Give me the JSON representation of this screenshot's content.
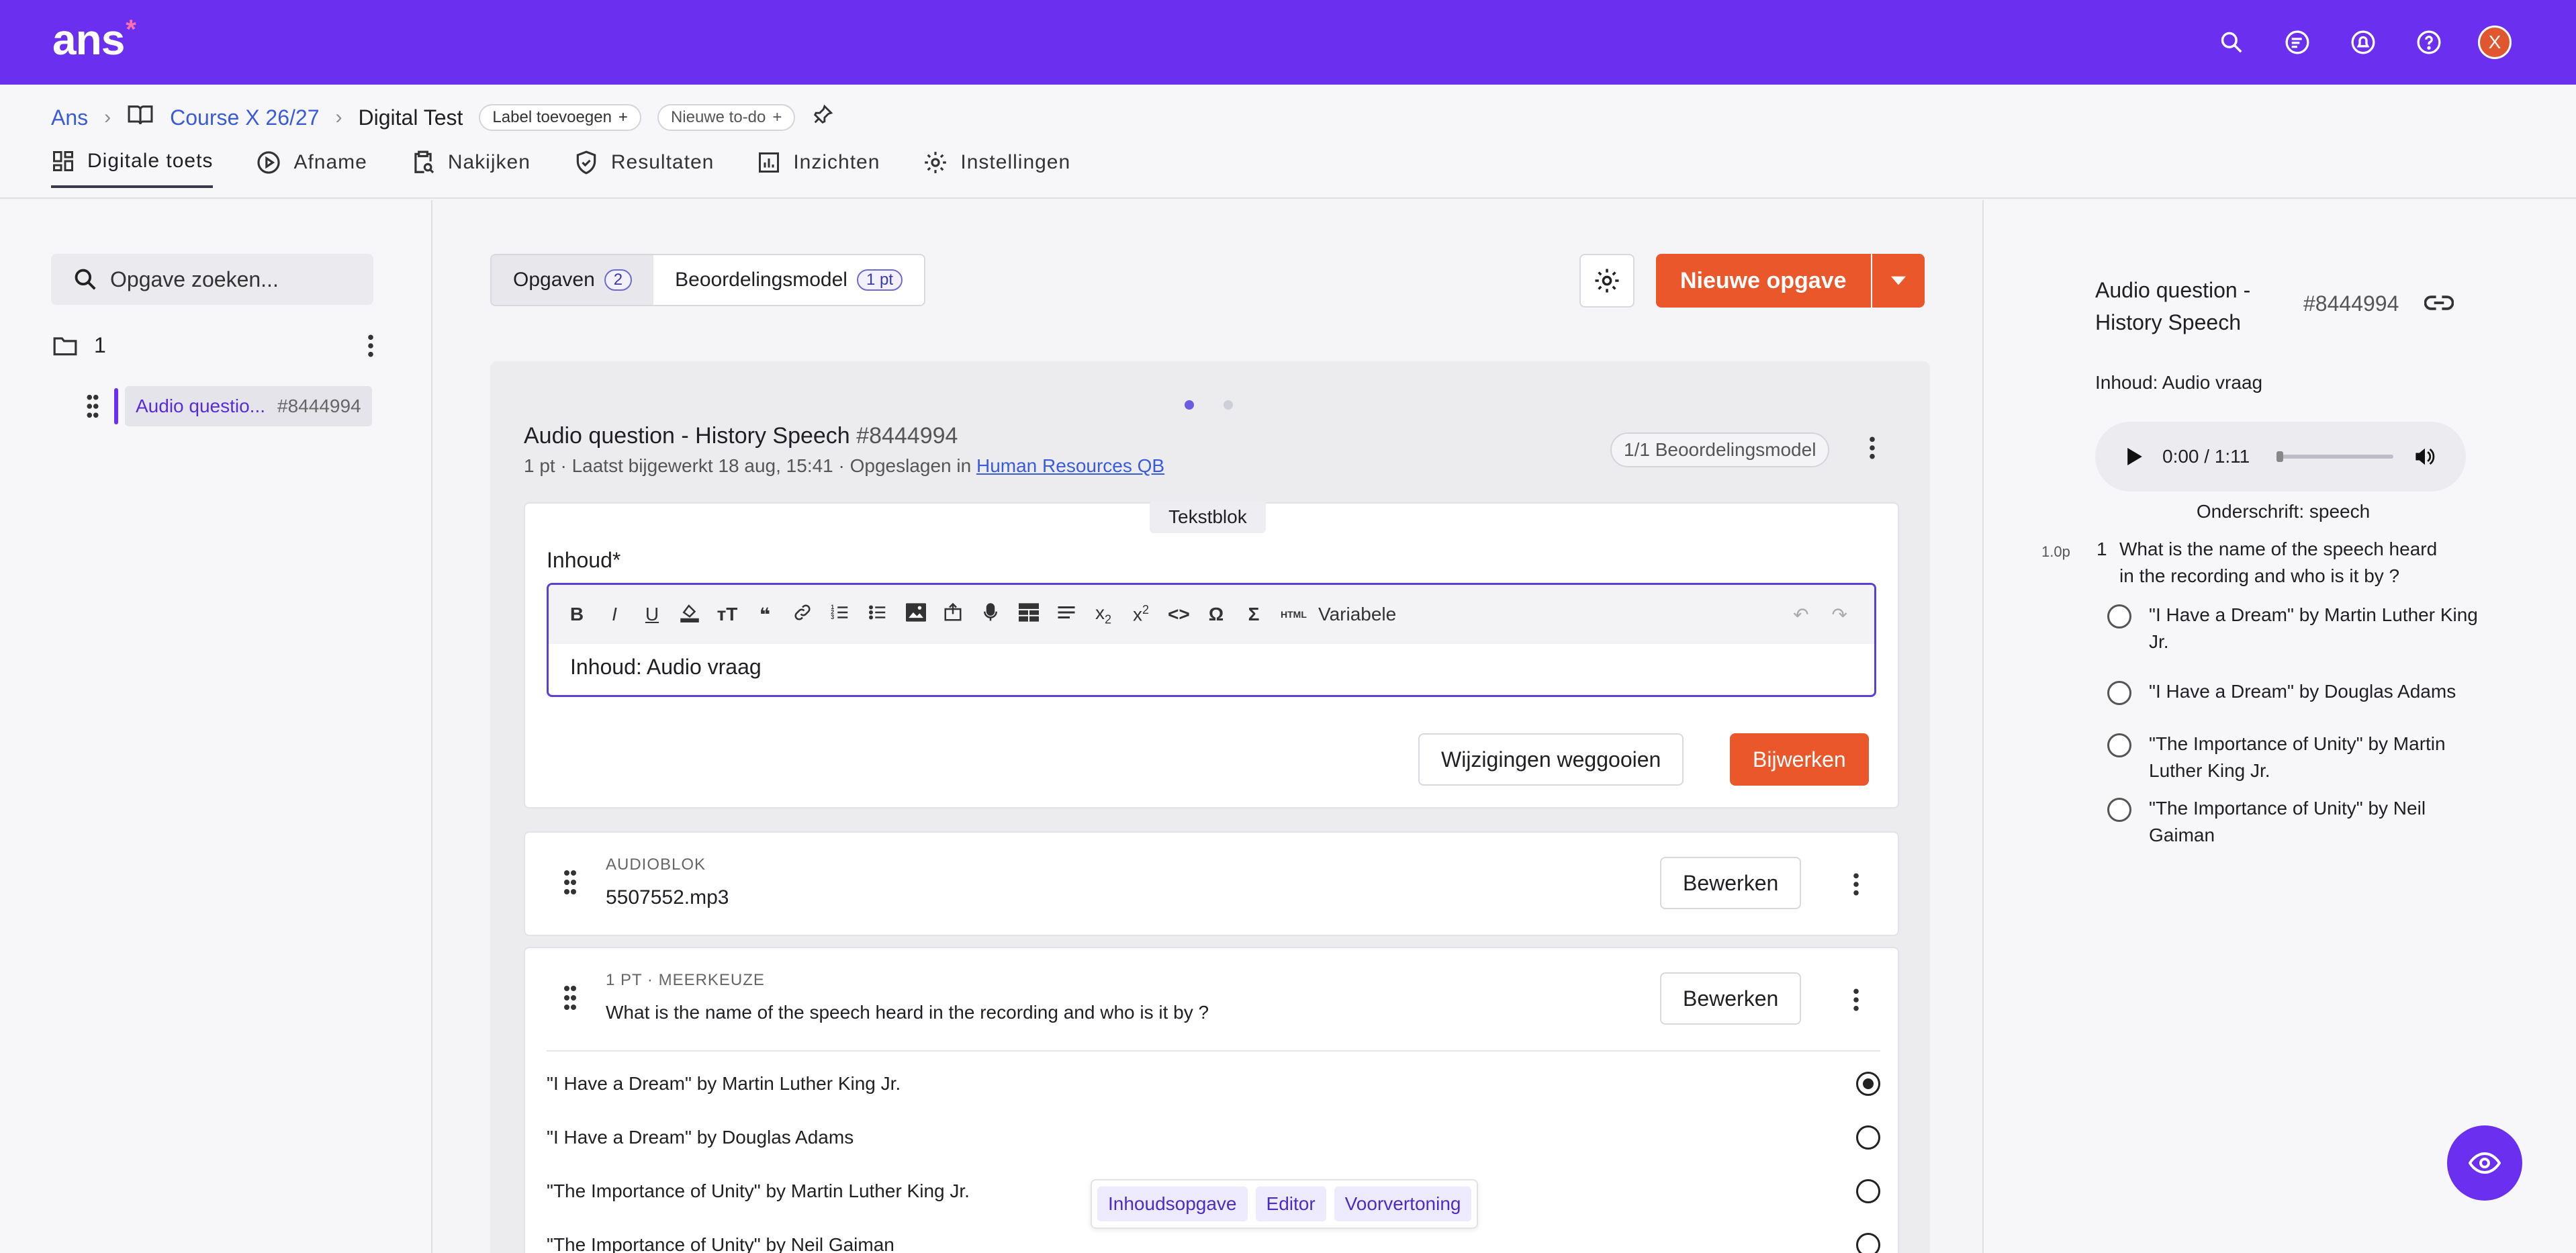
{
  "app": {
    "logo": "ans",
    "logo_mark": "*",
    "avatar_initial": "X",
    "accent": "#6b2ff0",
    "action_color": "#e9572a"
  },
  "top_icons": [
    "search-icon",
    "list-icon",
    "bell-icon",
    "help-icon"
  ],
  "breadcrumb": {
    "root": "Ans",
    "course": "Course X 26/27",
    "current": "Digital Test",
    "label_pill": "Label toevoegen",
    "todo_pill": "Nieuwe to-do"
  },
  "tabs": [
    "Digitale toets",
    "Afname",
    "Nakijken",
    "Resultaten",
    "Inzichten",
    "Instellingen"
  ],
  "sidebar": {
    "search_placeholder": "Opgave zoeken...",
    "folder": "1",
    "item_title": "Audio questio...",
    "item_id": "#8444994"
  },
  "main": {
    "seg_questions": "Opgaven",
    "seg_questions_count": "2",
    "seg_model": "Beoordelingsmodel",
    "seg_model_badge": "1 pt",
    "new_button": "Nieuwe opgave",
    "question_title": "Audio question - History Speech",
    "question_id": "#8444994",
    "meta_prefix": "1 pt · Laatst bijgewerkt 18 aug, 15:41 · Opgeslagen in",
    "meta_link": "Human Resources QB",
    "model_pill": "1/1 Beoordelingsmodel",
    "textblock_tag": "Tekstblok",
    "content_label": "Inhoud*",
    "toolbar_variable": "Variabele",
    "editor_text": "Inhoud: Audio vraag",
    "discard_button": "Wijzigingen weggooien",
    "update_button": "Bijwerken",
    "audio_tag": "AUDIOBLOK",
    "audio_file": "5507552.mp3",
    "edit_label": "Bewerken",
    "mc_tag": "1 PT · MEERKEUZE",
    "mc_question": "What is the name of the speech heard in the recording and who is it by ?",
    "options": [
      {
        "text": "\"I Have a Dream\" by Martin Luther King Jr.",
        "selected": true
      },
      {
        "text": "\"I Have a Dream\" by Douglas Adams",
        "selected": false
      },
      {
        "text": "\"The Importance of Unity\" by Martin Luther King Jr.",
        "selected": false
      },
      {
        "text": "\"The Importance of Unity\" by Neil Gaiman",
        "selected": false
      }
    ],
    "float_bar": [
      "Inhoudsopgave",
      "Editor",
      "Voorvertoning"
    ]
  },
  "preview": {
    "title": "Audio question - History Speech",
    "id": "#8444994",
    "content": "Inhoud: Audio vraag",
    "audio_time": "0:00 / 1:11",
    "caption": "Onderschrift: speech",
    "points": "1.0p",
    "number": "1",
    "question": "What is the name of the speech heard in the recording and who is it by ?",
    "options": [
      "\"I Have a Dream\" by Martin Luther King Jr.",
      "\"I Have a Dream\" by Douglas Adams",
      "\"The Importance of Unity\" by Martin Luther King Jr.",
      "\"The Importance of Unity\" by Neil Gaiman"
    ]
  }
}
